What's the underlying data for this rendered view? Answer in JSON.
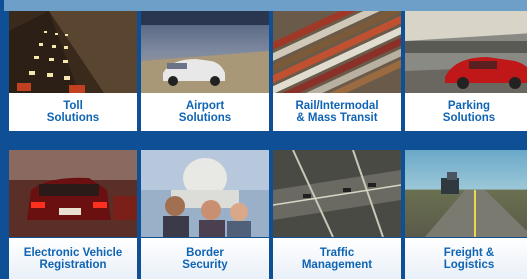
{
  "tiles_row1": [
    {
      "label": "Toll\nSolutions",
      "icon": "highway-traffic-photo"
    },
    {
      "label": "Airport\nSolutions",
      "icon": "airport-car-photo"
    },
    {
      "label": "Rail/Intermodal\n& Mass Transit",
      "icon": "rail-yard-photo"
    },
    {
      "label": "Parking\nSolutions",
      "icon": "parking-garage-photo"
    }
  ],
  "tiles_row2": [
    {
      "label": "Electronic Vehicle\nRegistration",
      "icon": "vehicle-rear-photo"
    },
    {
      "label": "Border\nSecurity",
      "icon": "capitol-people-photo"
    },
    {
      "label": "Traffic\nManagement",
      "icon": "traffic-intersection-photo"
    },
    {
      "label": "Freight &\nLogistics",
      "icon": "truck-highway-photo"
    }
  ],
  "colors": {
    "frame": "#0f4f96",
    "label_text": "#0f64b4",
    "topbar": "#6d9fc8"
  }
}
